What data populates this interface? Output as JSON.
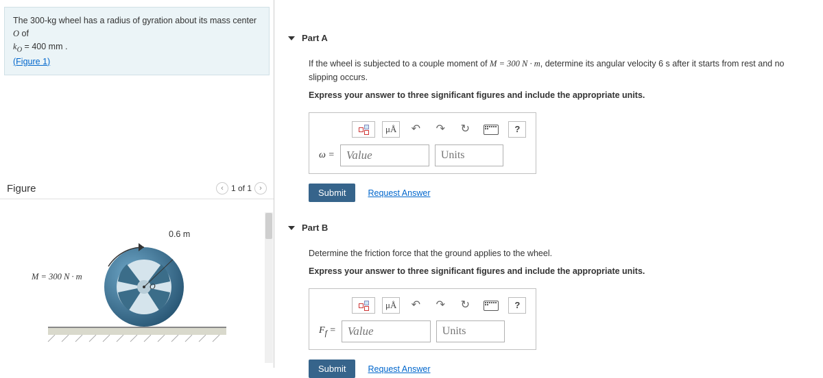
{
  "problem": {
    "mass_text": "300-kg",
    "body_prefix": " wheel has a radius of gyration about its mass center ",
    "center_symbol": "O",
    "body_suffix": " of",
    "ko_line_prefix": "k",
    "ko_sub": "O",
    "ko_value": " = 400 mm .",
    "figure_link": "(Figure 1)"
  },
  "figure": {
    "title": "Figure",
    "pager": "1 of 1",
    "radius_label": "0.6 m",
    "moment_label": "M = 300 N · m",
    "center_label": "O"
  },
  "partA": {
    "title": "Part A",
    "prompt_prefix": "If the wheel is subjected to a couple moment of ",
    "moment_expr": "M = 300 N · m",
    "prompt_suffix": ", determine its angular velocity 6 s after it starts from rest and no slipping occurs.",
    "instruction": "Express your answer to three significant figures and include the appropriate units.",
    "var_label": "ω =",
    "value_ph": "Value",
    "units_ph": "Units",
    "submit": "Submit",
    "request": "Request Answer"
  },
  "partB": {
    "title": "Part B",
    "prompt": "Determine the friction force that the ground applies to the wheel.",
    "instruction": "Express your answer to three significant figures and include the appropriate units.",
    "var_label_main": "F",
    "var_label_sub": "f",
    "var_label_eq": " =",
    "value_ph": "Value",
    "units_ph": "Units",
    "submit": "Submit",
    "request": "Request Answer"
  },
  "toolbar": {
    "mu_a": "μÅ",
    "question": "?"
  }
}
